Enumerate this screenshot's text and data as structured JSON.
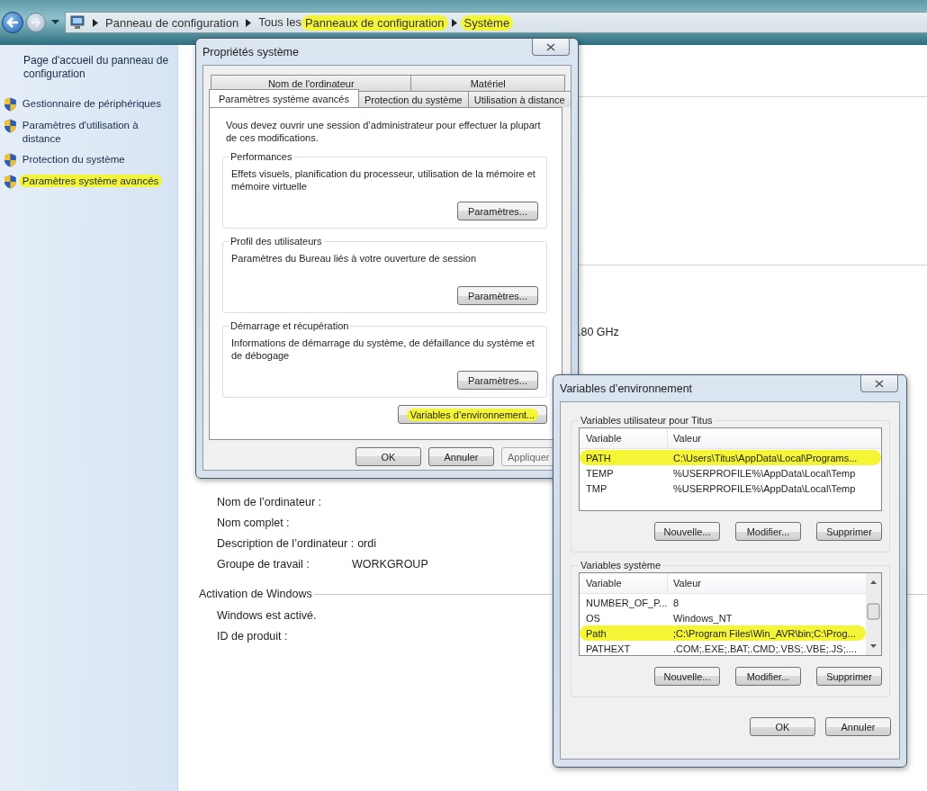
{
  "address_bar": {
    "crumbs": [
      {
        "label": "Panneau de configuration",
        "highlighted": false
      },
      {
        "lead": "Tous les",
        "label": "Panneaux de configuration",
        "highlighted": true
      },
      {
        "label": "Système",
        "highlighted": true
      }
    ]
  },
  "sidebar": {
    "home_link": "Page d'accueil du panneau de configuration",
    "items": [
      {
        "label": "Gestionnaire de périphériques",
        "highlighted": false
      },
      {
        "label": "Paramètres d'utilisation à distance",
        "highlighted": false
      },
      {
        "label": "Protection du système",
        "highlighted": false
      },
      {
        "label": "Paramètres système avancés",
        "highlighted": true
      }
    ]
  },
  "main": {
    "partial_text": ".80 GHz",
    "computer_rows": [
      {
        "label": "Nom de l’ordinateur :"
      },
      {
        "label": "Nom complet :"
      },
      {
        "label": "Description de l’ordinateur :",
        "value": "ordi"
      },
      {
        "label": "Groupe de travail :",
        "value": "WORKGROUP"
      }
    ],
    "activation": {
      "title": "Activation de Windows",
      "rows": [
        {
          "label": "Windows est activé."
        },
        {
          "label": "ID de produit :"
        }
      ]
    }
  },
  "props_dialog": {
    "title": "Propriétés système",
    "tab_rows": [
      [
        {
          "label": "Nom de l'ordinateur",
          "selected": false
        },
        {
          "label": "Matériel",
          "selected": false
        }
      ],
      [
        {
          "label": "Paramètres système avancés",
          "selected": true
        },
        {
          "label": "Protection du système",
          "selected": false
        },
        {
          "label": "Utilisation à distance",
          "selected": false
        }
      ]
    ],
    "intro": "Vous devez ouvrir une session d’administrateur pour effectuer la plupart de ces modifications.",
    "groups": [
      {
        "title": "Performances",
        "text": "Effets visuels, planification du processeur, utilisation de la mémoire et mémoire virtuelle",
        "button": "Paramètres..."
      },
      {
        "title": "Profil des utilisateurs",
        "text": "Paramètres du Bureau liés à votre ouverture de session",
        "button": "Paramètres..."
      },
      {
        "title": "Démarrage et récupération",
        "text": "Informations de démarrage du système, de défaillance du système et de débogage",
        "button": "Paramètres..."
      }
    ],
    "env_button": {
      "label": "Variables d’environnement...",
      "highlighted": true
    },
    "buttons": [
      {
        "label": "OK",
        "disabled": false
      },
      {
        "label": "Annuler",
        "disabled": false
      },
      {
        "label": "Appliquer",
        "disabled": true
      }
    ]
  },
  "env_dialog": {
    "title": "Variables d’environnement",
    "sections": [
      {
        "title": "Variables utilisateur pour Titus",
        "columns": [
          "Variable",
          "Valeur"
        ],
        "has_scrollbar": false,
        "rows": [
          {
            "variable": "PATH",
            "value": "C:\\Users\\Titus\\AppData\\Local\\Programs...",
            "highlighted": true
          },
          {
            "variable": "TEMP",
            "value": "%USERPROFILE%\\AppData\\Local\\Temp",
            "highlighted": false
          },
          {
            "variable": "TMP",
            "value": "%USERPROFILE%\\AppData\\Local\\Temp",
            "highlighted": false
          }
        ],
        "buttons": [
          "Nouvelle...",
          "Modifier...",
          "Supprimer"
        ]
      },
      {
        "title": "Variables système",
        "columns": [
          "Variable",
          "Valeur"
        ],
        "has_scrollbar": true,
        "rows": [
          {
            "variable": "NUMBER_OF_P...",
            "value": "8",
            "highlighted": false
          },
          {
            "variable": "OS",
            "value": "Windows_NT",
            "highlighted": false
          },
          {
            "variable": "Path",
            "value": ";C:\\Program Files\\Win_AVR\\bin;C:\\Prog...",
            "highlighted": true
          },
          {
            "variable": "PATHEXT",
            "value": ".COM;.EXE;.BAT;.CMD;.VBS;.VBE;.JS;....",
            "highlighted": false
          }
        ],
        "buttons": [
          "Nouvelle...",
          "Modifier...",
          "Supprimer"
        ]
      }
    ],
    "buttons": [
      "OK",
      "Annuler"
    ]
  }
}
